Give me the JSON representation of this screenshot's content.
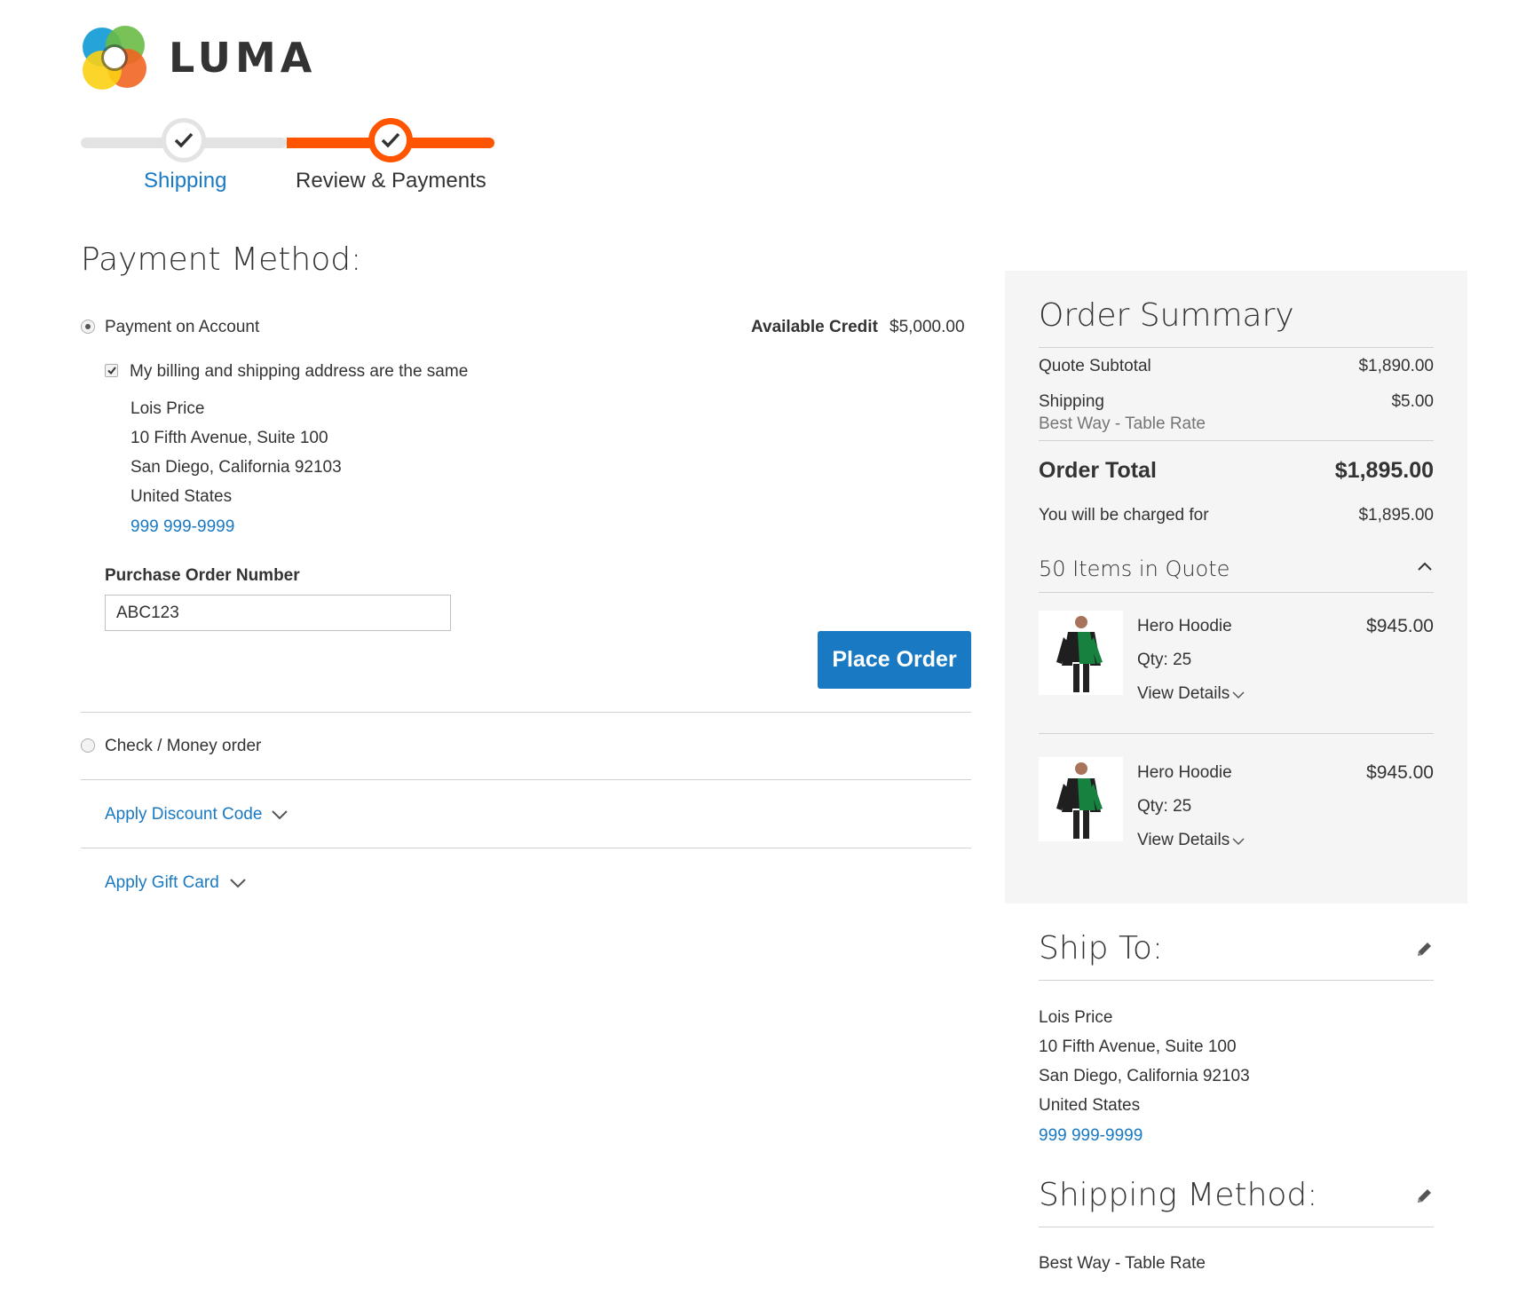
{
  "brand": {
    "name": "LUMA"
  },
  "progress": {
    "steps": [
      {
        "label": "Shipping",
        "state": "complete"
      },
      {
        "label": "Review & Payments",
        "state": "active"
      }
    ]
  },
  "payment": {
    "title": "Payment Method:",
    "methods": [
      {
        "label": "Payment on Account",
        "selected": true
      },
      {
        "label": "Check / Money order",
        "selected": false
      }
    ],
    "available_credit_label": "Available Credit",
    "available_credit_value": "$5,000.00",
    "same_address_label": "My billing and shipping address are the same",
    "same_address_checked": true,
    "address": {
      "name": "Lois Price",
      "street": "10 Fifth Avenue, Suite 100",
      "city_line": "San Diego, California 92103",
      "country": "United States",
      "phone": "999 999-9999"
    },
    "po_label": "Purchase Order Number",
    "po_value": "ABC123",
    "place_order_label": "Place Order",
    "discount_label": "Apply Discount Code",
    "gift_card_label": "Apply Gift Card"
  },
  "summary": {
    "title": "Order Summary",
    "subtotal_label": "Quote Subtotal",
    "subtotal_value": "$1,890.00",
    "shipping_label": "Shipping",
    "shipping_method": "Best Way - Table Rate",
    "shipping_value": "$5.00",
    "total_label": "Order Total",
    "total_value": "$1,895.00",
    "charged_label": "You will be charged for",
    "charged_value": "$1,895.00",
    "items_label": "50 Items in Quote",
    "items": [
      {
        "name": "Hero Hoodie",
        "qty": "Qty: 25",
        "price": "$945.00",
        "details": "View Details"
      },
      {
        "name": "Hero Hoodie",
        "qty": "Qty: 25",
        "price": "$945.00",
        "details": "View Details"
      }
    ]
  },
  "ship_to": {
    "title": "Ship To:",
    "name": "Lois Price",
    "street": "10 Fifth Avenue, Suite 100",
    "city_line": "San Diego, California 92103",
    "country": "United States",
    "phone": "999 999-9999"
  },
  "shipping_method": {
    "title": "Shipping Method:",
    "value": "Best Way - Table Rate"
  },
  "colors": {
    "accent_orange": "#ff5501",
    "link_blue": "#1979c3",
    "summary_bg": "#f5f5f5",
    "text": "#333333"
  },
  "icons": [
    "luma-logo-icon",
    "check-icon",
    "chevron-down-icon",
    "chevron-up-icon",
    "pencil-icon"
  ]
}
